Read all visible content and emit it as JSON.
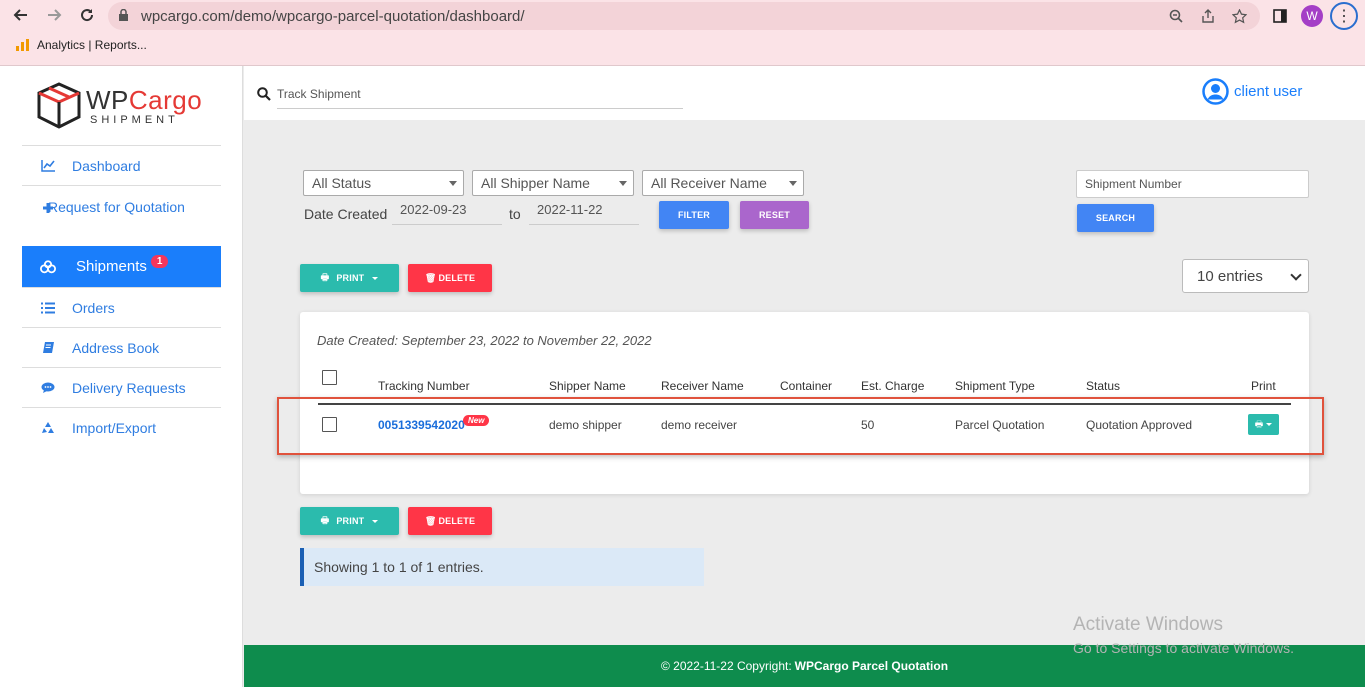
{
  "browser": {
    "url": "wpcargo.com/demo/wpcargo-parcel-quotation/dashboard/",
    "profile_initial": "W",
    "bookmark": "Analytics | Reports..."
  },
  "logo": {
    "wp": "WP",
    "cargo": "Cargo",
    "sub": "SHIPMENT"
  },
  "sidebar": {
    "items": [
      {
        "label": "Dashboard",
        "icon": "line-chart-icon"
      },
      {
        "label": "Request for Quotation",
        "icon": "plus-icon"
      },
      {
        "label": "Shipments",
        "icon": "cubes-icon",
        "badge": "1",
        "active": true
      },
      {
        "label": "Orders",
        "icon": "list-icon"
      },
      {
        "label": "Address Book",
        "icon": "book-icon"
      },
      {
        "label": "Delivery Requests",
        "icon": "chat-icon"
      },
      {
        "label": "Import/Export",
        "icon": "recycle-icon"
      }
    ]
  },
  "topbar": {
    "track_placeholder": "Track Shipment",
    "user": "client user"
  },
  "filters": {
    "status": "All Status",
    "shipper": "All Shipper Name",
    "receiver": "All Receiver Name",
    "date_label": "Date Created",
    "date_from": "2022-09-23",
    "to_label": "to",
    "date_to": "2022-11-22",
    "filter_btn": "FILTER",
    "reset_btn": "RESET",
    "shipment_number_placeholder": "Shipment Number",
    "search_btn": "SEARCH"
  },
  "actions": {
    "print": "PRINT",
    "delete": "DELETE",
    "entries": "10 entries"
  },
  "table": {
    "caption": "Date Created: September 23, 2022 to November 22, 2022",
    "headers": [
      "Tracking Number",
      "Shipper Name",
      "Receiver Name",
      "Container",
      "Est. Charge",
      "Shipment Type",
      "Status",
      "Print"
    ],
    "rows": [
      {
        "tracking": "0051339542020",
        "new_badge": "New",
        "shipper": "demo shipper",
        "receiver": "demo receiver",
        "container": "",
        "charge": "50",
        "type": "Parcel Quotation",
        "status": "Quotation Approved"
      }
    ]
  },
  "info": "Showing 1 to 1 of 1 entries.",
  "watermark": {
    "line1": "Activate Windows",
    "line2": "Go to Settings to activate Windows."
  },
  "footer": {
    "text": "© 2022-11-22 Copyright:",
    "brand": "WPCargo Parcel Quotation"
  },
  "colors": {
    "primary": "#1a7efb",
    "print": "#2bbbad",
    "delete": "#ff3547",
    "reset": "#aa66cc",
    "footer": "#0e8c4d"
  }
}
